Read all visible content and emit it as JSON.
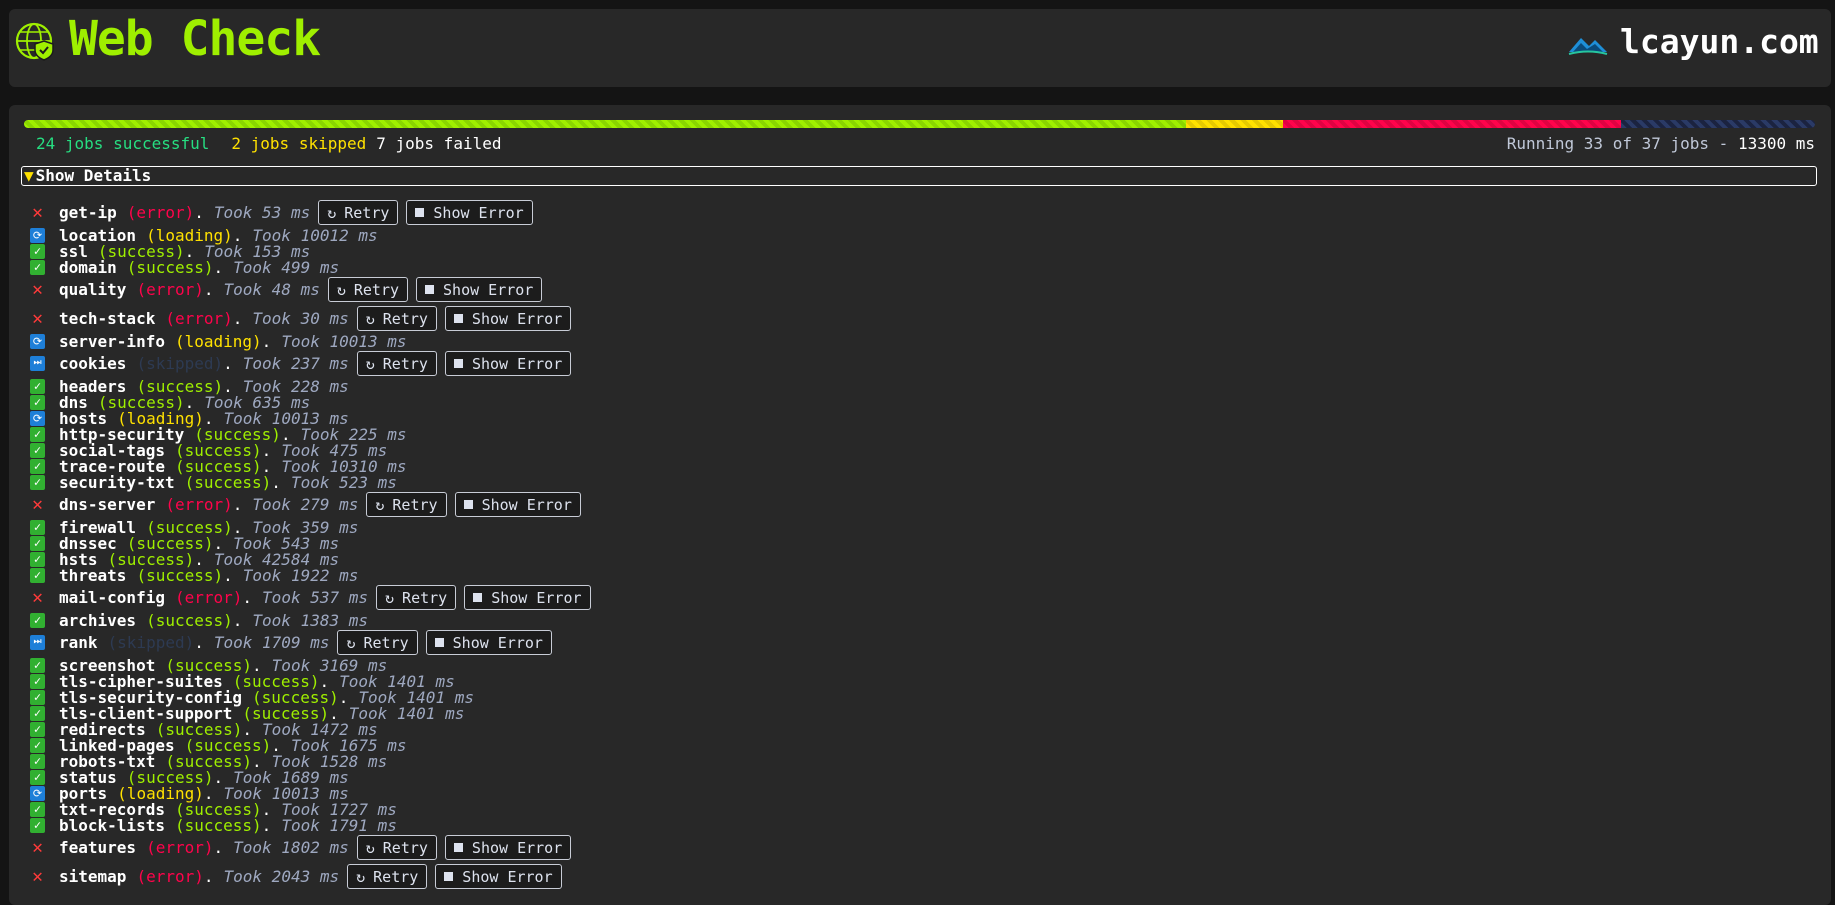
{
  "header": {
    "title": "Web Check",
    "site": "lcayun.com",
    "colors": {
      "accent": "#9fef00",
      "background": "#141414",
      "card": "#282828"
    }
  },
  "progress": {
    "successful_label": "24 jobs successful",
    "skipped_label": "2 jobs skipped",
    "failed_label": "7 jobs failed",
    "running_label": "Running 33 of 37 jobs -",
    "elapsed_label": "13300 ms",
    "successful": 24,
    "skipped": 2,
    "failed": 7,
    "pending": 4,
    "total": 37
  },
  "details_toggle": {
    "label": "Show Details",
    "icon": "triangle-down-icon"
  },
  "buttons": {
    "retry": "Retry",
    "show_error": "Show Error"
  },
  "jobs": [
    {
      "name": "get-ip",
      "state": "error",
      "state_label": "(error)",
      "took": "Took 53 ms"
    },
    {
      "name": "location",
      "state": "loading",
      "state_label": "(loading)",
      "took": "Took 10012 ms"
    },
    {
      "name": "ssl",
      "state": "success",
      "state_label": "(success)",
      "took": "Took 153 ms"
    },
    {
      "name": "domain",
      "state": "success",
      "state_label": "(success)",
      "took": "Took 499 ms"
    },
    {
      "name": "quality",
      "state": "error",
      "state_label": "(error)",
      "took": "Took 48 ms"
    },
    {
      "name": "tech-stack",
      "state": "error",
      "state_label": "(error)",
      "took": "Took 30 ms"
    },
    {
      "name": "server-info",
      "state": "loading",
      "state_label": "(loading)",
      "took": "Took 10013 ms"
    },
    {
      "name": "cookies",
      "state": "skipped",
      "state_label": "(skipped)",
      "took": "Took 237 ms"
    },
    {
      "name": "headers",
      "state": "success",
      "state_label": "(success)",
      "took": "Took 228 ms"
    },
    {
      "name": "dns",
      "state": "success",
      "state_label": "(success)",
      "took": "Took 635 ms"
    },
    {
      "name": "hosts",
      "state": "loading",
      "state_label": "(loading)",
      "took": "Took 10013 ms"
    },
    {
      "name": "http-security",
      "state": "success",
      "state_label": "(success)",
      "took": "Took 225 ms"
    },
    {
      "name": "social-tags",
      "state": "success",
      "state_label": "(success)",
      "took": "Took 475 ms"
    },
    {
      "name": "trace-route",
      "state": "success",
      "state_label": "(success)",
      "took": "Took 10310 ms"
    },
    {
      "name": "security-txt",
      "state": "success",
      "state_label": "(success)",
      "took": "Took 523 ms"
    },
    {
      "name": "dns-server",
      "state": "error",
      "state_label": "(error)",
      "took": "Took 279 ms"
    },
    {
      "name": "firewall",
      "state": "success",
      "state_label": "(success)",
      "took": "Took 359 ms"
    },
    {
      "name": "dnssec",
      "state": "success",
      "state_label": "(success)",
      "took": "Took 543 ms"
    },
    {
      "name": "hsts",
      "state": "success",
      "state_label": "(success)",
      "took": "Took 42584 ms"
    },
    {
      "name": "threats",
      "state": "success",
      "state_label": "(success)",
      "took": "Took 1922 ms"
    },
    {
      "name": "mail-config",
      "state": "error",
      "state_label": "(error)",
      "took": "Took 537 ms"
    },
    {
      "name": "archives",
      "state": "success",
      "state_label": "(success)",
      "took": "Took 1383 ms"
    },
    {
      "name": "rank",
      "state": "skipped",
      "state_label": "(skipped)",
      "took": "Took 1709 ms"
    },
    {
      "name": "screenshot",
      "state": "success",
      "state_label": "(success)",
      "took": "Took 3169 ms"
    },
    {
      "name": "tls-cipher-suites",
      "state": "success",
      "state_label": "(success)",
      "took": "Took 1401 ms"
    },
    {
      "name": "tls-security-config",
      "state": "success",
      "state_label": "(success)",
      "took": "Took 1401 ms"
    },
    {
      "name": "tls-client-support",
      "state": "success",
      "state_label": "(success)",
      "took": "Took 1401 ms"
    },
    {
      "name": "redirects",
      "state": "success",
      "state_label": "(success)",
      "took": "Took 1472 ms"
    },
    {
      "name": "linked-pages",
      "state": "success",
      "state_label": "(success)",
      "took": "Took 1675 ms"
    },
    {
      "name": "robots-txt",
      "state": "success",
      "state_label": "(success)",
      "took": "Took 1528 ms"
    },
    {
      "name": "status",
      "state": "success",
      "state_label": "(success)",
      "took": "Took 1689 ms"
    },
    {
      "name": "ports",
      "state": "loading",
      "state_label": "(loading)",
      "took": "Took 10013 ms"
    },
    {
      "name": "txt-records",
      "state": "success",
      "state_label": "(success)",
      "took": "Took 1727 ms"
    },
    {
      "name": "block-lists",
      "state": "success",
      "state_label": "(success)",
      "took": "Took 1791 ms"
    },
    {
      "name": "features",
      "state": "error",
      "state_label": "(error)",
      "took": "Took 1802 ms"
    },
    {
      "name": "sitemap",
      "state": "error",
      "state_label": "(error)",
      "took": "Took 2043 ms"
    }
  ]
}
